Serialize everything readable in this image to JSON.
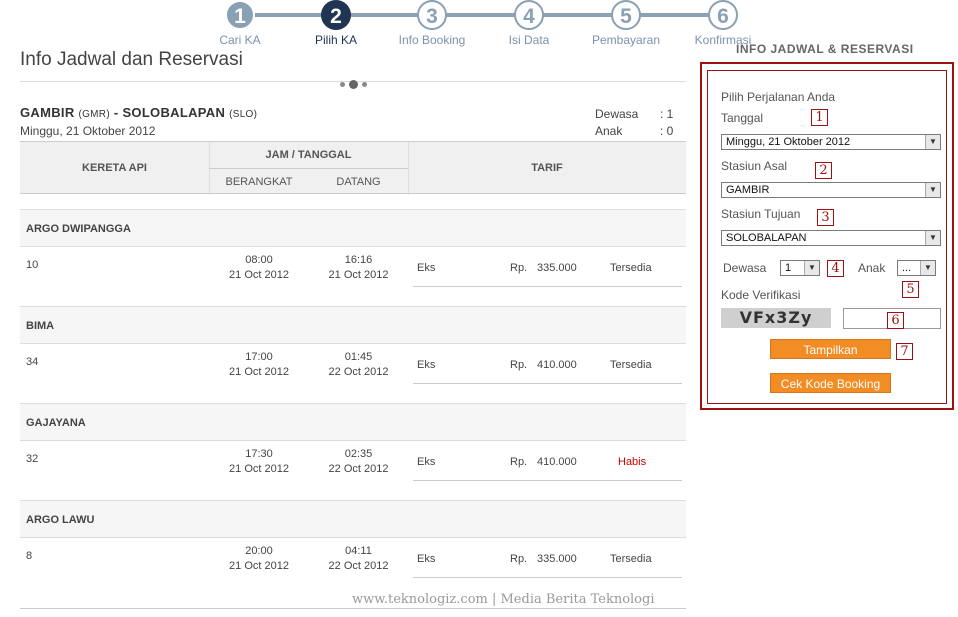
{
  "stepper": {
    "steps": [
      {
        "num": "1",
        "label": "Cari KA"
      },
      {
        "num": "2",
        "label": "Pilih KA"
      },
      {
        "num": "3",
        "label": "Info Booking"
      },
      {
        "num": "4",
        "label": "Isi Data"
      },
      {
        "num": "5",
        "label": "Pembayaran"
      },
      {
        "num": "6",
        "label": "Konfirmasi"
      }
    ],
    "active_step": 2
  },
  "page_title": "Info Jadwal dan Reservasi",
  "route": {
    "origin": "GAMBIR",
    "origin_code": "(GMR)",
    "separator": "-",
    "destination": "SOLOBALAPAN",
    "destination_code": "(SLO)",
    "date": "Minggu, 21 Oktober 2012"
  },
  "passengers": {
    "adult_label": "Dewasa",
    "adult_value": ": 1",
    "child_label": "Anak",
    "child_value": ": 0"
  },
  "table": {
    "headers": {
      "train": "KERETA API",
      "time_date": "JAM / TANGGAL",
      "depart": "BERANGKAT",
      "arrive": "DATANG",
      "fare": "TARIF"
    },
    "trains": [
      {
        "name": "ARGO DWIPANGGA",
        "number": "10",
        "dep_time": "08:00",
        "dep_date": "21 Oct 2012",
        "arr_time": "16:16",
        "arr_date": "21 Oct 2012",
        "class": "Eks",
        "currency": "Rp.",
        "price": "335.000",
        "status": "Tersedia"
      },
      {
        "name": "BIMA",
        "number": "34",
        "dep_time": "17:00",
        "dep_date": "21 Oct 2012",
        "arr_time": "01:45",
        "arr_date": "22 Oct 2012",
        "class": "Eks",
        "currency": "Rp.",
        "price": "410.000",
        "status": "Tersedia"
      },
      {
        "name": "GAJAYANA",
        "number": "32",
        "dep_time": "17:30",
        "dep_date": "21 Oct 2012",
        "arr_time": "02:35",
        "arr_date": "22 Oct 2012",
        "class": "Eks",
        "currency": "Rp.",
        "price": "410.000",
        "status": "Habis"
      },
      {
        "name": "ARGO LAWU",
        "number": "8",
        "dep_time": "20:00",
        "dep_date": "21 Oct 2012",
        "arr_time": "04:11",
        "arr_date": "22 Oct 2012",
        "class": "Eks",
        "currency": "Rp.",
        "price": "335.000",
        "status": "Tersedia"
      }
    ]
  },
  "watermark": "www.teknologiz.com  |  Media Berita Teknologi",
  "sidebar": {
    "title": "INFO JADWAL & RESERVASI",
    "intro": "Pilih Perjalanan Anda",
    "date_label": "Tanggal",
    "date_value": "Minggu, 21 Oktober 2012",
    "origin_label": "Stasiun Asal",
    "origin_value": "GAMBIR",
    "dest_label": "Stasiun Tujuan",
    "dest_value": "SOLOBALAPAN",
    "adult_label": "Dewasa",
    "adult_value": "1",
    "child_label": "Anak",
    "child_value": "...",
    "verify_label": "Kode Verifikasi",
    "captcha_text": "VFx3Zy",
    "submit_label": "Tampilkan",
    "booking_label": "Cek Kode Booking",
    "markers": [
      "1",
      "2",
      "3",
      "4",
      "5",
      "6",
      "7"
    ]
  },
  "colors": {
    "accent_dark": "#1f3552",
    "step_inactive": "#8aa0b3",
    "button_orange": "#f28c24",
    "annotation_red": "#a01010",
    "sold_out": "#cc0000"
  }
}
